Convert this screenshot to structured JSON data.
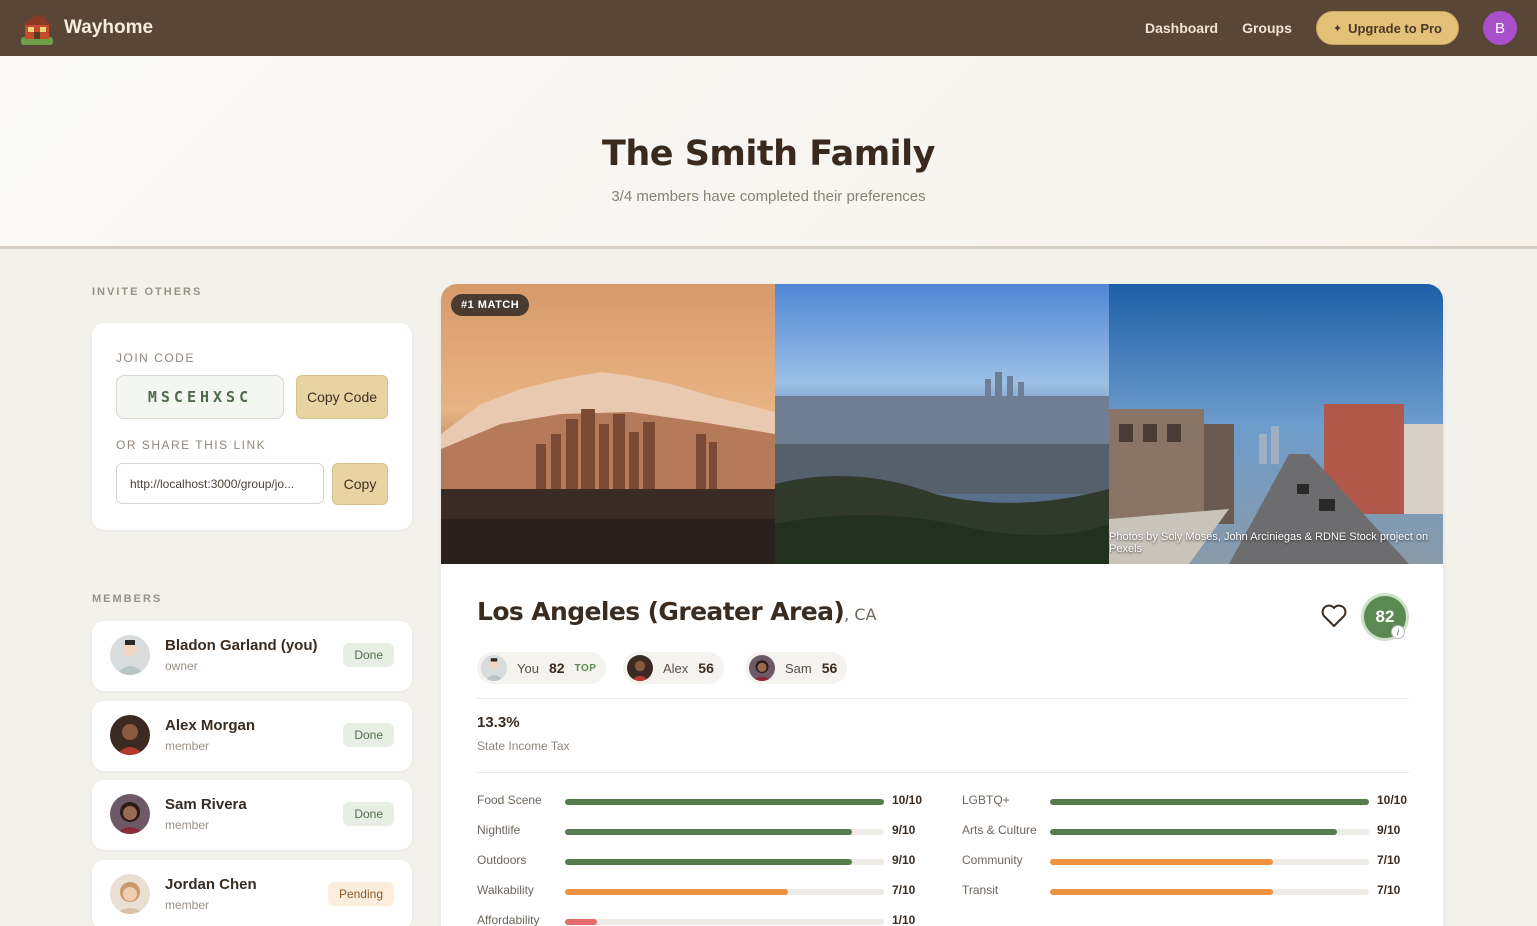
{
  "app": {
    "name": "Wayhome",
    "avatar_initial": "B"
  },
  "nav": {
    "dashboard": "Dashboard",
    "groups": "Groups",
    "upgrade": "Upgrade to Pro"
  },
  "hero": {
    "title": "The Smith Family",
    "subtitle": "3/4 members have completed their preferences"
  },
  "invite": {
    "section": "INVITE OTHERS",
    "join_code_label": "JOIN CODE",
    "join_code": "MSCEHXSC",
    "copy_code": "Copy Code",
    "share_label": "OR SHARE THIS LINK",
    "share_link": "http://localhost:3000/group/jo...",
    "copy": "Copy"
  },
  "members": {
    "section": "MEMBERS",
    "list": [
      {
        "name": "Bladon Garland (you)",
        "role": "owner",
        "status": "Done"
      },
      {
        "name": "Alex Morgan",
        "role": "member",
        "status": "Done"
      },
      {
        "name": "Sam Rivera",
        "role": "member",
        "status": "Done"
      },
      {
        "name": "Jordan Chen",
        "role": "member",
        "status": "Pending"
      }
    ]
  },
  "match": {
    "badge": "#1 MATCH",
    "credit": "Photos by Soly Moses, John Arciniegas & RDNE Stock project on Pexels",
    "city": "Los Angeles (Greater Area)",
    "state": ", CA",
    "score": "82",
    "info": "i",
    "member_scores": [
      {
        "name": "You",
        "score": "82",
        "tag": "TOP"
      },
      {
        "name": "Alex",
        "score": "56"
      },
      {
        "name": "Sam",
        "score": "56"
      }
    ],
    "tax": {
      "value": "13.3%",
      "label": "State Income Tax"
    },
    "metrics_left": [
      {
        "label": "Food Scene",
        "value": "10/10",
        "score": 10,
        "color": "#567c4e"
      },
      {
        "label": "Nightlife",
        "value": "9/10",
        "score": 9,
        "color": "#567c4e"
      },
      {
        "label": "Outdoors",
        "value": "9/10",
        "score": 9,
        "color": "#567c4e"
      },
      {
        "label": "Walkability",
        "value": "7/10",
        "score": 7,
        "color": "#ef9240"
      },
      {
        "label": "Affordability",
        "value": "1/10",
        "score": 1,
        "color": "#e66b6b"
      }
    ],
    "metrics_right": [
      {
        "label": "LGBTQ+",
        "value": "10/10",
        "score": 10,
        "color": "#567c4e"
      },
      {
        "label": "Arts & Culture",
        "value": "9/10",
        "score": 9,
        "color": "#567c4e"
      },
      {
        "label": "Community",
        "value": "7/10",
        "score": 7,
        "color": "#ef9240"
      },
      {
        "label": "Transit",
        "value": "7/10",
        "score": 7,
        "color": "#ef9240"
      }
    ]
  },
  "icons": {
    "logo": "house-logo-icon",
    "favorite": "heart-icon",
    "upgrade": "sparkle-icon",
    "info": "info-icon"
  }
}
